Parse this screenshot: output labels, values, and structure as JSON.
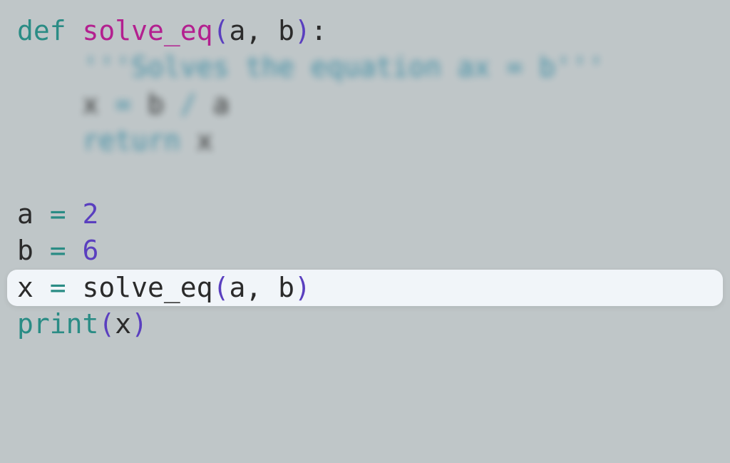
{
  "code": {
    "line1": {
      "def": "def ",
      "fn": "solve_eq",
      "lp": "(",
      "a": "a",
      "comma": ", ",
      "b": "b",
      "rp": ")",
      "colon": ":"
    },
    "line2": {
      "indent": "    ",
      "doc": "'''Solves the equation ax = b'''"
    },
    "line3": {
      "indent": "    ",
      "x": "x ",
      "eq": "= ",
      "b": "b ",
      "div": "/ ",
      "a": "a"
    },
    "line4": {
      "indent": "    ",
      "ret": "return ",
      "x": "x"
    },
    "line6": {
      "a": "a ",
      "eq": "= ",
      "val": "2"
    },
    "line7": {
      "b": "b ",
      "eq": "= ",
      "val": "6"
    },
    "line8": {
      "x": "x ",
      "eq": "= ",
      "fn": "solve_eq",
      "lp": "(",
      "a": "a",
      "comma": ", ",
      "b": "b",
      "rp": ")"
    },
    "line9": {
      "print": "print",
      "lp": "(",
      "x": "x",
      "rp": ")"
    }
  }
}
